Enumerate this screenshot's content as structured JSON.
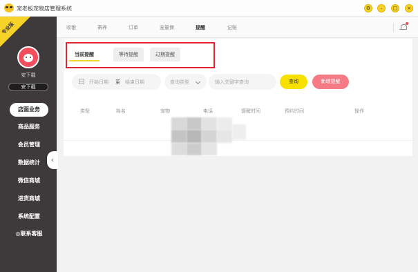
{
  "app": {
    "title": "宠老板宠物店管理系统",
    "window_controls": [
      {
        "name": "settings",
        "glyph": "⚙"
      },
      {
        "name": "minimize",
        "glyph": "–"
      },
      {
        "name": "maximize",
        "glyph": "□"
      },
      {
        "name": "close",
        "glyph": "×"
      }
    ]
  },
  "sidebar": {
    "edition_badge": "专业版",
    "shop_name": "安下载",
    "user_badge": "安下载",
    "items": [
      {
        "label": "店面业务",
        "active": true
      },
      {
        "label": "商品服务"
      },
      {
        "label": "会员管理"
      },
      {
        "label": "数据统计"
      },
      {
        "label": "微信商城"
      },
      {
        "label": "进货商城"
      },
      {
        "label": "系统配置"
      },
      {
        "label": "◎联系客服"
      }
    ],
    "collapse_glyph": "‹"
  },
  "topnav": {
    "tabs": [
      {
        "label": "收银"
      },
      {
        "label": "寄养"
      },
      {
        "label": "订单"
      },
      {
        "label": "宠量保"
      },
      {
        "label": "提醒",
        "active": true
      },
      {
        "label": "记账"
      }
    ]
  },
  "subtabs": [
    {
      "label": "当前提醒",
      "active": true
    },
    {
      "label": "等待提醒"
    },
    {
      "label": "过期提醒"
    }
  ],
  "filters": {
    "start_date_placeholder": "开始日期",
    "to_label": "至",
    "end_date_placeholder": "结束日期",
    "type_placeholder": "查询类型",
    "keyword_placeholder": "输入关键字查询",
    "query_button": "查询",
    "add_button": "新增提醒"
  },
  "table": {
    "headers": [
      "类型",
      "姓名",
      "宠物",
      "电话",
      "提醒时间",
      "预约时间",
      "操作"
    ],
    "rows": []
  },
  "colors": {
    "accent_yellow": "#f7d229",
    "sidebar_bg": "#3e3a3b",
    "add_button_pink": "#f47b86",
    "highlight_red": "#e02233"
  }
}
